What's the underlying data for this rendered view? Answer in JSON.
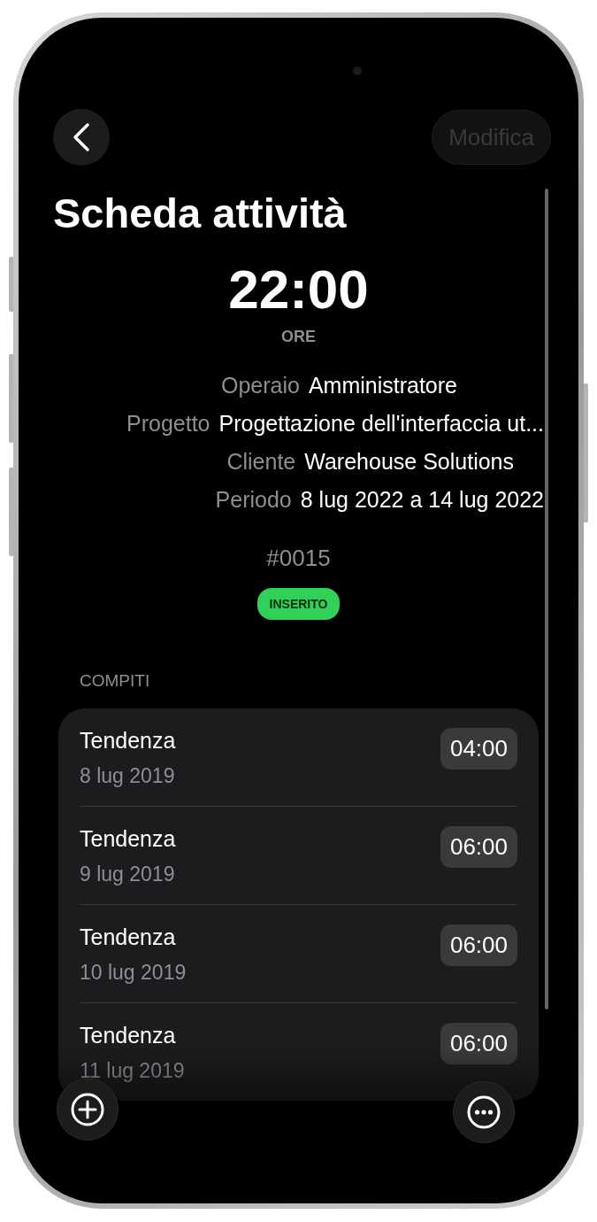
{
  "header": {
    "edit_button": {
      "label": "Modifica",
      "disabled": true
    }
  },
  "title": "Scheda attività",
  "total": {
    "value": "22:00",
    "unit": "ORE"
  },
  "details": [
    {
      "label": "Operaio",
      "value": "Amministratore"
    },
    {
      "label": "Progetto",
      "value": "Progettazione dell'interfaccia ut..."
    },
    {
      "label": "Cliente",
      "value": "Warehouse Solutions"
    },
    {
      "label": "Periodo",
      "value": "8 lug 2022 a 14 lug 2022"
    }
  ],
  "code": "#0015",
  "status": "INSERITO",
  "tasks": {
    "header": "COMPITI",
    "items": [
      {
        "name": "Tendenza",
        "date": "8 lug 2019",
        "time": "04:00"
      },
      {
        "name": "Tendenza",
        "date": "9 lug 2019",
        "time": "06:00"
      },
      {
        "name": "Tendenza",
        "date": "10 lug 2019",
        "time": "06:00"
      },
      {
        "name": "Tendenza",
        "date": "11 lug 2019",
        "time": "06:00"
      }
    ]
  }
}
